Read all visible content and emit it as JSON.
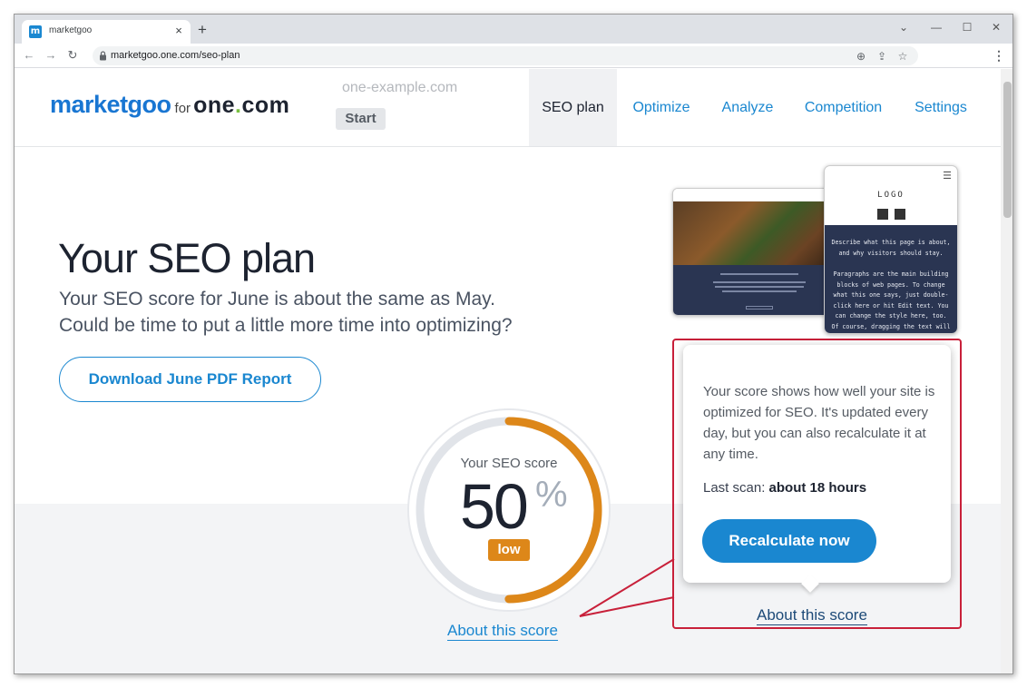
{
  "browser": {
    "tab_title": "marketgoo",
    "tab_favicon": "m",
    "tab_close": "×",
    "new_tab": "+",
    "url": "marketgoo.one.com/seo-plan",
    "controls": {
      "minimize": "—",
      "maximize": "☐",
      "close": "✕",
      "chevron": "⌄"
    },
    "nav": {
      "back": "←",
      "forward": "→",
      "reload": "↻"
    },
    "icons": {
      "zoom": "⊕",
      "share": "⇪",
      "bookmark": "☆",
      "menu": "⋮"
    }
  },
  "header": {
    "logo": {
      "main": "marketgoo",
      "for": "for",
      "one_a": "one",
      "dot": ".",
      "one_b": "com"
    },
    "domain": "one-example.com",
    "start_label": "Start",
    "nav": [
      "SEO plan",
      "Optimize",
      "Analyze",
      "Competition",
      "Settings"
    ],
    "active_nav": "SEO plan"
  },
  "hero": {
    "title": "Your SEO plan",
    "subtitle_line1": "Your SEO score for June is about the same as May.",
    "subtitle_line2": "Could be time to put a little more time into optimizing?",
    "download_label": "Download June PDF Report"
  },
  "score": {
    "label": "Your SEO score",
    "value": "50",
    "percent_sign": "%",
    "fraction": 0.5,
    "badge": "low",
    "badge_color": "#dd8719",
    "about_link": "About this score"
  },
  "mockup": {
    "phone_logo": "LOGO",
    "phone_text1": "Describe what this page is about, and why visitors should stay.",
    "phone_text2": "Paragraphs are the main building blocks of web pages. To change what this one says, just double-click here or hit Edit text. You can change the style here, too. Of course, dragging the text will move the paragraph on the page."
  },
  "popup": {
    "text": "Your score shows how well your site is optimized for SEO. It's updated every day, but you can also recalculate it at any time.",
    "scan_label": "Last scan:",
    "scan_value": "about 18 hours",
    "button_label": "Recalculate now",
    "about_link": "About this score"
  },
  "colors": {
    "accent": "#1a87d0",
    "navy": "#1d2330",
    "highlight": "#c8203a",
    "gauge_track": "#e1e4e9"
  }
}
